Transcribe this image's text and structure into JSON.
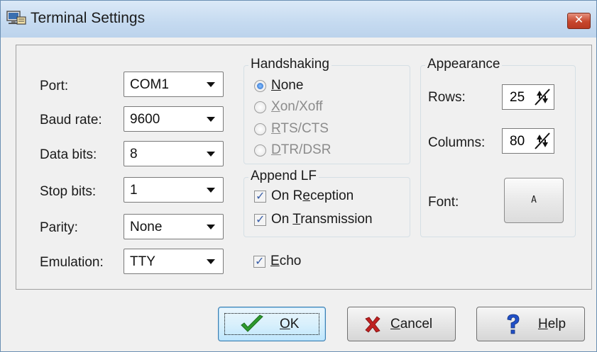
{
  "window": {
    "title": "Terminal Settings",
    "close_label": "✕"
  },
  "serial": {
    "port": {
      "label": "Port:",
      "value": "COM1"
    },
    "baud": {
      "label": "Baud rate:",
      "value": "9600"
    },
    "data_bits": {
      "label": "Data bits:",
      "value": "8"
    },
    "stop_bits": {
      "label": "Stop bits:",
      "value": "1"
    },
    "parity": {
      "label": "Parity:",
      "value": "None"
    },
    "emulation": {
      "label": "Emulation:",
      "value": "TTY"
    }
  },
  "handshaking": {
    "title": "Handshaking",
    "options": [
      {
        "pre": "",
        "key": "N",
        "post": "one",
        "checked": true
      },
      {
        "pre": "",
        "key": "X",
        "post": "on/Xoff",
        "checked": false
      },
      {
        "pre": "",
        "key": "R",
        "post": "TS/CTS",
        "checked": false
      },
      {
        "pre": "",
        "key": "D",
        "post": "TR/DSR",
        "checked": false
      }
    ]
  },
  "append_lf": {
    "title": "Append LF",
    "on_reception": {
      "pre": "On R",
      "key": "e",
      "post": "ception",
      "checked": true
    },
    "on_transmission": {
      "pre": "On ",
      "key": "T",
      "post": "ransmission",
      "checked": true
    }
  },
  "echo": {
    "pre": "",
    "key": "E",
    "post": "cho",
    "checked": true
  },
  "appearance": {
    "title": "Appearance",
    "rows": {
      "label": "Rows:",
      "value": "25"
    },
    "columns": {
      "label": "Columns:",
      "value": "80"
    },
    "font": {
      "label": "Font:",
      "sample": "A"
    }
  },
  "buttons": {
    "ok": {
      "key": "O",
      "post": "K"
    },
    "cancel": {
      "key": "C",
      "post": "ancel"
    },
    "help": {
      "key": "H",
      "post": "elp"
    }
  },
  "colors": {
    "titlebar": "#c5daf0",
    "close_button": "#c7462c",
    "ok_check": "#2e9a2e",
    "cancel_x": "#c02020",
    "help_question": "#2150c8"
  }
}
